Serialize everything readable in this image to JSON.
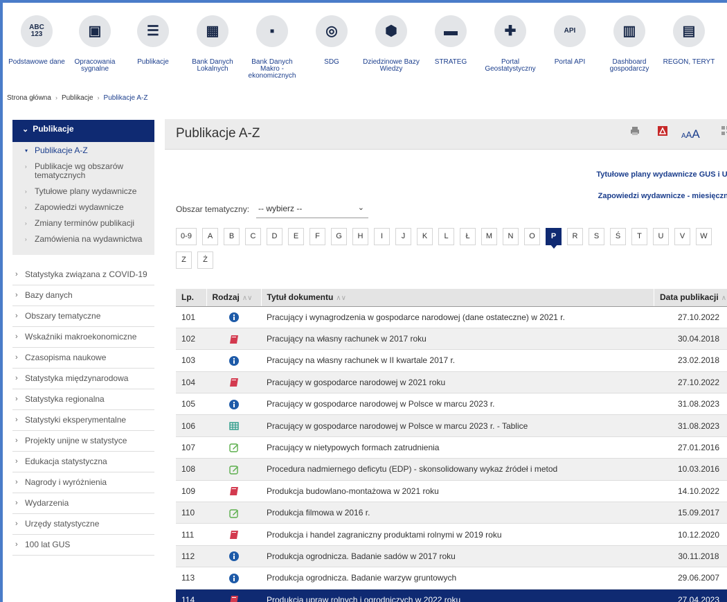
{
  "topnav": [
    {
      "label": "Podstawowe dane",
      "icon": "abc-123-icon",
      "glyph": "ABC\n123"
    },
    {
      "label": "Opracowania sygnalne",
      "icon": "signal-report-icon",
      "glyph": "▣"
    },
    {
      "label": "Publikacje",
      "icon": "publications-icon",
      "glyph": "☰"
    },
    {
      "label": "Bank Danych Lokalnych",
      "icon": "grid-database-icon",
      "glyph": "▦"
    },
    {
      "label": "Bank Danych Makro - ekonomicznych",
      "icon": "macro-data-icon",
      "glyph": "▪"
    },
    {
      "label": "SDG",
      "icon": "sdg-wheel-icon",
      "glyph": "◎"
    },
    {
      "label": "Dziedzinowe Bazy Wiedzy",
      "icon": "knowledge-base-icon",
      "glyph": "⬢"
    },
    {
      "label": "STRATEG",
      "icon": "strateg-icon",
      "glyph": "▬"
    },
    {
      "label": "Portal Geostatystyczny",
      "icon": "geostat-portal-icon",
      "glyph": "✚"
    },
    {
      "label": "Portal API",
      "icon": "api-portal-icon",
      "glyph": "API"
    },
    {
      "label": "Dashboard gospodarczy",
      "icon": "dashboard-chart-icon",
      "glyph": "▥"
    },
    {
      "label": "REGON, TERYT",
      "icon": "regon-teryt-icon",
      "glyph": "▤"
    }
  ],
  "breadcrumb": [
    "Strona główna",
    "Publikacje",
    "Publikacje A-Z"
  ],
  "sidebar": {
    "header": "Publikacje",
    "subitems": [
      "Publikacje A-Z",
      "Publikacje wg obszarów tematycznych",
      "Tytułowe plany wydawnicze",
      "Zapowiedzi wydawnicze",
      "Zmiany terminów publikacji",
      "Zamówienia na wydawnictwa"
    ],
    "items": [
      "Statystyka związana z COVID-19",
      "Bazy danych",
      "Obszary tematyczne",
      "Wskaźniki makroekonomiczne",
      "Czasopisma naukowe",
      "Statystyka międzynarodowa",
      "Statystyka regionalna",
      "Statystyki eksperymentalne",
      "Projekty unijne w statystyce",
      "Edukacja statystyczna",
      "Nagrody i wyróżnienia",
      "Wydarzenia",
      "Urzędy statystyczne",
      "100 lat GUS"
    ]
  },
  "main": {
    "title": "Publikacje A-Z",
    "font_small": "A",
    "font_mid": "A",
    "font_big": "A",
    "link1": "Tytułowe plany wydawnicze GUS i US",
    "link2": "Zapowiedzi wydawnicze - miesięczne",
    "filter_label": "Obszar tematyczny:",
    "filter_value": "-- wybierz --",
    "letters": [
      "0-9",
      "A",
      "B",
      "C",
      "D",
      "E",
      "F",
      "G",
      "H",
      "I",
      "J",
      "K",
      "L",
      "Ł",
      "M",
      "N",
      "O",
      "P",
      "R",
      "S",
      "Ś",
      "T",
      "U",
      "V",
      "W",
      "Z",
      "Ż"
    ],
    "active_letter": "P",
    "columns": [
      "Lp.",
      "Rodzaj",
      "Tytuł dokumentu",
      "Data publikacji"
    ],
    "rows": [
      {
        "lp": "101",
        "type": "info",
        "title": "Pracujący i wynagrodzenia w gospodarce narodowej (dane ostateczne) w 2021 r.",
        "date": "27.10.2022"
      },
      {
        "lp": "102",
        "type": "book",
        "title": "Pracujący na własny rachunek w 2017 roku",
        "date": "30.04.2018"
      },
      {
        "lp": "103",
        "type": "info",
        "title": "Pracujący na własny rachunek w II kwartale 2017 r.",
        "date": "23.02.2018"
      },
      {
        "lp": "104",
        "type": "book",
        "title": "Pracujący w gospodarce narodowej w 2021 roku",
        "date": "27.10.2022"
      },
      {
        "lp": "105",
        "type": "info",
        "title": "Pracujący w gospodarce narodowej w Polsce w marcu 2023 r.",
        "date": "31.08.2023"
      },
      {
        "lp": "106",
        "type": "table",
        "title": "Pracujący w gospodarce narodowej w Polsce w marcu 2023 r. - Tablice",
        "date": "31.08.2023"
      },
      {
        "lp": "107",
        "type": "edit",
        "title": "Pracujący w nietypowych formach zatrudnienia",
        "date": "27.01.2016"
      },
      {
        "lp": "108",
        "type": "edit",
        "title": "Procedura nadmiernego deficytu (EDP) - skonsolidowany wykaz źródeł i metod",
        "date": "10.03.2016"
      },
      {
        "lp": "109",
        "type": "book",
        "title": "Produkcja budowlano-montażowa w 2021 roku",
        "date": "14.10.2022"
      },
      {
        "lp": "110",
        "type": "edit",
        "title": "Produkcja filmowa w 2016 r.",
        "date": "15.09.2017"
      },
      {
        "lp": "111",
        "type": "book",
        "title": "Produkcja i handel zagraniczny produktami rolnymi w 2019 roku",
        "date": "10.12.2020"
      },
      {
        "lp": "112",
        "type": "info",
        "title": "Produkcja ogrodnicza. Badanie sadów w 2017 roku",
        "date": "30.11.2018"
      },
      {
        "lp": "113",
        "type": "info",
        "title": "Produkcja ogrodnicza. Badanie warzyw gruntowych",
        "date": "29.06.2007"
      },
      {
        "lp": "114",
        "type": "book",
        "title": "Produkcja upraw rolnych i ogrodniczych w 2022 roku",
        "date": "27.04.2023"
      }
    ],
    "selected_row": "114"
  },
  "colors": {
    "navy": "#0f2a72",
    "info": "#1d5aa8",
    "book": "#d33a4f",
    "table": "#2a9a88",
    "edit": "#5aad4a",
    "pdf": "#c62828",
    "printer": "#888888"
  }
}
